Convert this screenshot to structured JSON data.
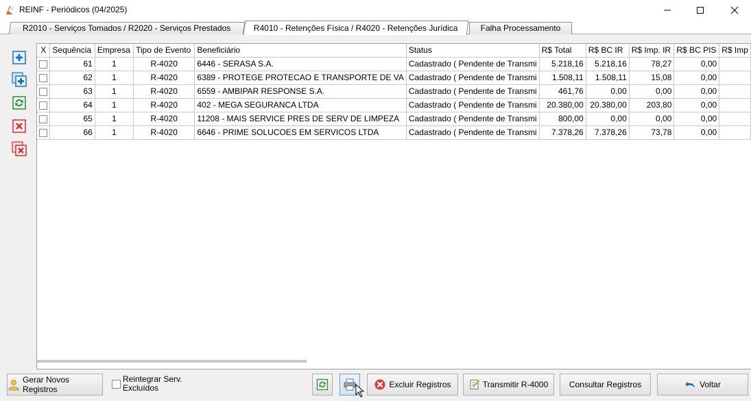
{
  "window": {
    "title": "REINF - Periódicos (04/2025)",
    "minimize": "—",
    "maximize": "☐",
    "close": "✕"
  },
  "tabs": [
    {
      "label": "R2010 - Serviços Tomados / R2020 - Serviços Prestados",
      "active": false
    },
    {
      "label": "R4010 - Retenções Física / R4020 - Retenções Jurídica",
      "active": true
    },
    {
      "label": "Falha Processamento",
      "active": false
    }
  ],
  "left_toolbar": [
    {
      "icon": "add-record-icon"
    },
    {
      "icon": "add-multiple-icon"
    },
    {
      "icon": "refresh-icon"
    },
    {
      "icon": "delete-record-icon"
    },
    {
      "icon": "delete-multiple-icon"
    }
  ],
  "table": {
    "columns": [
      "X",
      "Sequência",
      "Empresa",
      "Tipo de Evento",
      "Beneficiário",
      "Status",
      "R$ Total",
      "R$ BC IR",
      "R$ Imp. IR",
      "R$ BC PIS",
      "R$ Imp"
    ],
    "rows": [
      [
        "",
        "61",
        "1",
        "R-4020",
        "6446 - SERASA S.A.",
        "Cadastrado ( Pendente de Transmi",
        "5.218,16",
        "5.218,16",
        "78,27",
        "0,00",
        ""
      ],
      [
        "",
        "62",
        "1",
        "R-4020",
        "6389 - PROTEGE PROTECAO E TRANSPORTE DE VA",
        "Cadastrado ( Pendente de Transmi",
        "1.508,11",
        "1.508,11",
        "15,08",
        "0,00",
        ""
      ],
      [
        "",
        "63",
        "1",
        "R-4020",
        "6559 - AMBIPAR RESPONSE S.A.",
        "Cadastrado ( Pendente de Transmi",
        "461,76",
        "0,00",
        "0,00",
        "0,00",
        ""
      ],
      [
        "",
        "64",
        "1",
        "R-4020",
        "402 - MEGA SEGURANCA LTDA",
        "Cadastrado ( Pendente de Transmi",
        "20.380,00",
        "20.380,00",
        "203,80",
        "0,00",
        ""
      ],
      [
        "",
        "65",
        "1",
        "R-4020",
        "11208 - MAIS SERVICE PRES DE SERV DE LIMPEZA",
        "Cadastrado ( Pendente de Transmi",
        "800,00",
        "0,00",
        "0,00",
        "0,00",
        ""
      ],
      [
        "",
        "66",
        "1",
        "R-4020",
        "6646 - PRIME SOLUCOES EM SERVICOS LTDA",
        "Cadastrado ( Pendente de Transmi",
        "7.378,26",
        "7.378,26",
        "73,78",
        "0,00",
        ""
      ]
    ]
  },
  "bottom": {
    "gerar": "Gerar Novos Registros",
    "reintegrar": "Reintegrar  Serv. Excluídos",
    "excluir": "Excluir Registros",
    "transmitir": "Transmitir R-4000",
    "consultar": "Consultar Registros",
    "voltar": "Voltar"
  },
  "colors": {
    "accent_blue": "#1e6fc8",
    "delete_red": "#d32f2f",
    "refresh_green": "#2e8b3d"
  }
}
